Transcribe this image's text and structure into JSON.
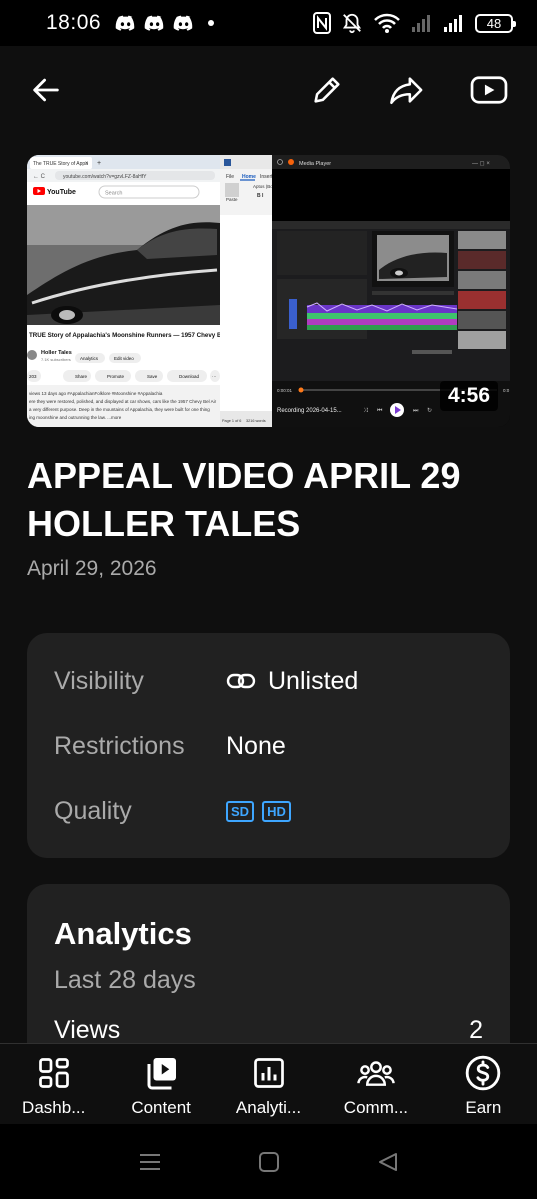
{
  "status_bar": {
    "time": "18:06",
    "battery": "48",
    "notification_icons": [
      "discord-icon",
      "discord-icon",
      "discord-icon"
    ]
  },
  "toolbar": {
    "back_icon": "arrow-left-icon",
    "edit_icon": "pencil-icon",
    "share_icon": "share-arrow-icon",
    "youtube_icon": "youtube-play-icon"
  },
  "thumbnail": {
    "duration": "4:56",
    "left_window": {
      "tab_title": "The TRUE Story of Appa",
      "url": "youtube.com/watch?v=gzvLFZ-8aHfY",
      "logo": "YouTube",
      "search_placeholder": "Search",
      "video_title": "TRUE Story of Appalachia's Moonshine Runners — 1957 Chevy B",
      "channel": "Holler Tales",
      "subscribers": "7.1K subscribers",
      "analytics_btn": "Analytics",
      "edit_btn": "Edit video",
      "likes": "203",
      "share": "Share",
      "promote": "Promote",
      "save": "Save",
      "download": "Download",
      "meta": "views  13 days ago  #AppalachianFolklore #Moonshine #Appalachia",
      "desc1": "ere they were restored, polished, and displayed at car shows, cars like the 1957 Chevy Bel Air",
      "desc2": "a very different purpose. Deep in the mountains of Appalachia, they were built for one thing",
      "desc3": "ing moonshine and outrunning the law.  ...more"
    },
    "middle_window": {
      "menu_file": "File",
      "menu_home": "Home",
      "menu_insert": "Insert",
      "paste": "Paste",
      "font": "Aptos (Bo",
      "page": "Page 1 of 6",
      "words": "3216 words"
    },
    "right_window": {
      "title": "Media Player",
      "time": "0:00:01",
      "recording": "Recording 2026-04-15...",
      "end_time": "0:0"
    }
  },
  "video": {
    "title": "APPEAL VIDEO APRIL 29 HOLLER TALES",
    "date": "April 29, 2026"
  },
  "details": {
    "visibility_label": "Visibility",
    "visibility_value": "Unlisted",
    "restrictions_label": "Restrictions",
    "restrictions_value": "None",
    "quality_label": "Quality",
    "quality_badges": [
      "SD",
      "HD"
    ]
  },
  "analytics": {
    "title": "Analytics",
    "period": "Last 28 days",
    "views_label": "Views",
    "views_value": "2"
  },
  "bottom_nav": {
    "items": [
      {
        "label": "Dashb...",
        "icon": "dashboard-icon"
      },
      {
        "label": "Content",
        "icon": "content-icon"
      },
      {
        "label": "Analyti...",
        "icon": "analytics-icon"
      },
      {
        "label": "Comm...",
        "icon": "community-icon"
      },
      {
        "label": "Earn",
        "icon": "earn-icon"
      }
    ]
  },
  "colors": {
    "background": "#0f0f0f",
    "card": "#212121",
    "accent_blue": "#3ea6ff",
    "secondary_text": "#aaaaaa"
  }
}
